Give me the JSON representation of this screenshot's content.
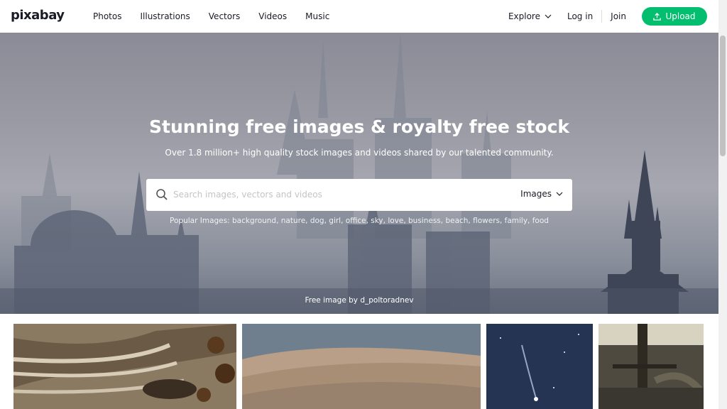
{
  "logo": "pixabay",
  "nav": {
    "items": [
      "Photos",
      "Illustrations",
      "Vectors",
      "Videos",
      "Music"
    ],
    "explore": "Explore",
    "login": "Log in",
    "join": "Join",
    "upload": "Upload"
  },
  "hero": {
    "title": "Stunning free images & royalty free stock",
    "subtitle": "Over 1.8 million+ high quality stock images and videos shared by our talented community.",
    "search_placeholder": "Search images, vectors and videos",
    "search_type": "Images",
    "popular": "Popular Images: background, nature, dog, girl, office, sky, love, business, beach, flowers, family, food",
    "credit": "Free image by d_poltoradnev"
  },
  "gallery": {
    "items": [
      "giraffe-photo",
      "dune-photo",
      "comet-night-photo",
      "bridge-photo"
    ]
  },
  "colors": {
    "accent": "#02be6e",
    "text": "#191b26"
  }
}
